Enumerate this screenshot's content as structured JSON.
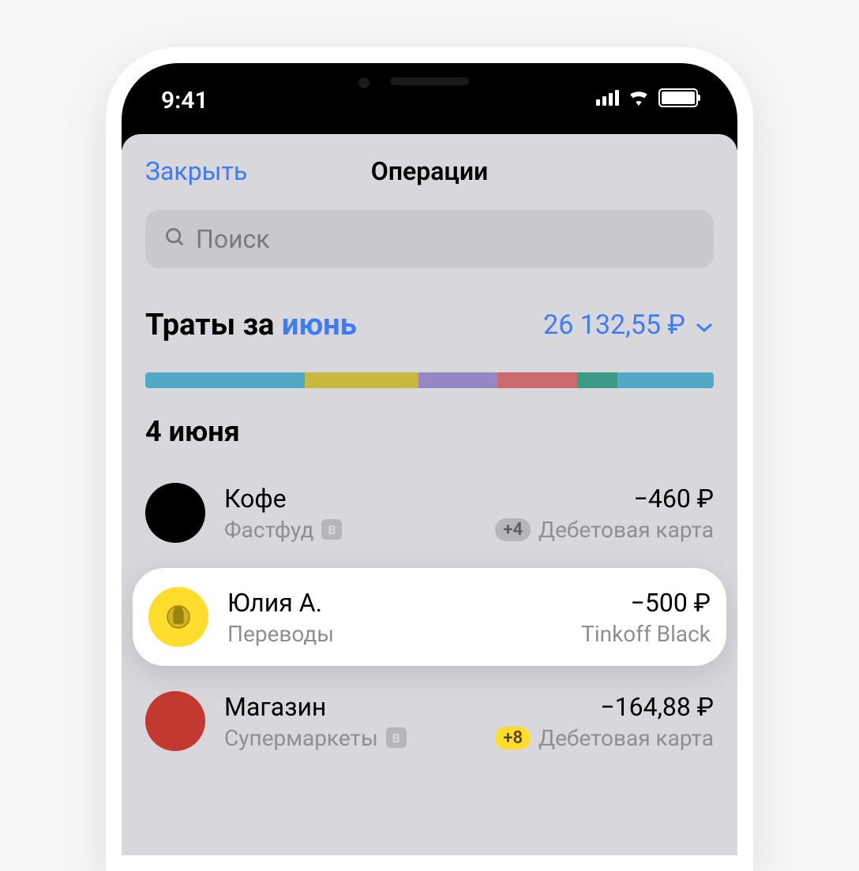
{
  "status_bar": {
    "time": "9:41"
  },
  "nav": {
    "close": "Закрыть",
    "title": "Операции"
  },
  "search": {
    "placeholder": "Поиск"
  },
  "summary": {
    "label_prefix": "Траты за ",
    "month": "июнь",
    "amount": "26 132,55 ₽"
  },
  "spending_segments": [
    {
      "color": "#52a9c7",
      "width": 28
    },
    {
      "color": "#c9b83e",
      "width": 20
    },
    {
      "color": "#9487c4",
      "width": 14
    },
    {
      "color": "#cc6b6e",
      "width": 14
    },
    {
      "color": "#3c9b87",
      "width": 7
    },
    {
      "color": "#52a9c7",
      "width": 17
    }
  ],
  "date_header": "4 июня",
  "transactions": [
    {
      "icon_color": "black",
      "name": "Кофе",
      "category": "Фастфуд",
      "has_category_badge": true,
      "amount": "−460 ₽",
      "count_badge": "+4",
      "count_badge_color": "gray",
      "account": "Дебетовая карта",
      "highlighted": false
    },
    {
      "icon_color": "yellow",
      "name": "Юлия А.",
      "category": "Переводы",
      "has_category_badge": false,
      "amount": "−500 ₽",
      "count_badge": "",
      "account": "Tinkoff Black",
      "highlighted": true
    },
    {
      "icon_color": "red",
      "name": "Магазин",
      "category": "Супермаркеты",
      "has_category_badge": true,
      "amount": "−164,88 ₽",
      "count_badge": "+8",
      "count_badge_color": "yellow",
      "account": "Дебетовая карта",
      "highlighted": false
    }
  ]
}
